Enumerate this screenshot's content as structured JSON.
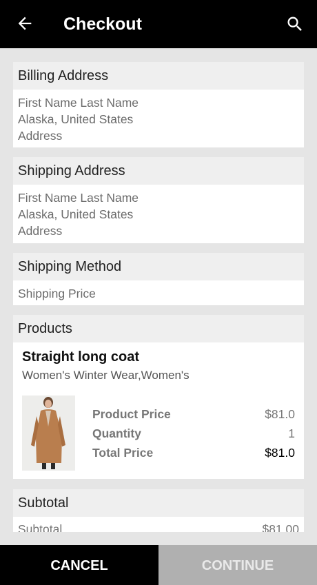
{
  "header": {
    "title": "Checkout",
    "back_icon": "arrow-left-icon",
    "search_icon": "search-icon"
  },
  "billing": {
    "title": "Billing Address",
    "name": "First Name Last Name",
    "region": "Alaska, United States",
    "address": "Address"
  },
  "shipping": {
    "title": "Shipping Address",
    "name": "First Name Last Name",
    "region": "Alaska, United States",
    "address": "Address"
  },
  "shipping_method": {
    "title": "Shipping Method",
    "price_label": "Shipping Price"
  },
  "products": {
    "title": "Products",
    "items": [
      {
        "name": "Straight long coat",
        "category": "Women's Winter Wear,Women's",
        "price_label": "Product Price",
        "price": "$81.0",
        "qty_label": "Quantity",
        "qty": "1",
        "total_label": "Total Price",
        "total": "$81.0"
      }
    ]
  },
  "subtotal": {
    "title": "Subtotal",
    "label": "Subtotal",
    "value": "$81.00"
  },
  "actions": {
    "cancel": "CANCEL",
    "continue": "CONTINUE"
  }
}
